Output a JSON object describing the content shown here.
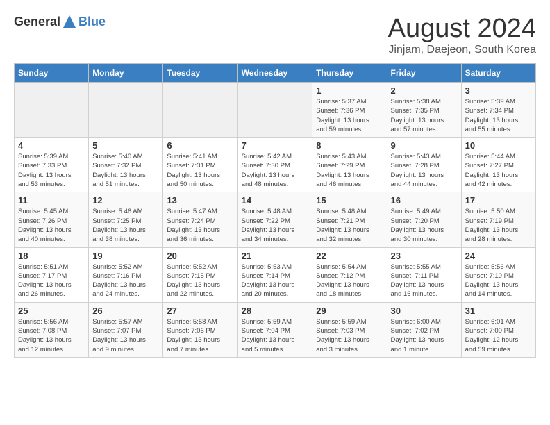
{
  "header": {
    "logo_general": "General",
    "logo_blue": "Blue",
    "month_title": "August 2024",
    "subtitle": "Jinjam, Daejeon, South Korea"
  },
  "weekdays": [
    "Sunday",
    "Monday",
    "Tuesday",
    "Wednesday",
    "Thursday",
    "Friday",
    "Saturday"
  ],
  "weeks": [
    [
      {
        "day": "",
        "info": ""
      },
      {
        "day": "",
        "info": ""
      },
      {
        "day": "",
        "info": ""
      },
      {
        "day": "",
        "info": ""
      },
      {
        "day": "1",
        "info": "Sunrise: 5:37 AM\nSunset: 7:36 PM\nDaylight: 13 hours\nand 59 minutes."
      },
      {
        "day": "2",
        "info": "Sunrise: 5:38 AM\nSunset: 7:35 PM\nDaylight: 13 hours\nand 57 minutes."
      },
      {
        "day": "3",
        "info": "Sunrise: 5:39 AM\nSunset: 7:34 PM\nDaylight: 13 hours\nand 55 minutes."
      }
    ],
    [
      {
        "day": "4",
        "info": "Sunrise: 5:39 AM\nSunset: 7:33 PM\nDaylight: 13 hours\nand 53 minutes."
      },
      {
        "day": "5",
        "info": "Sunrise: 5:40 AM\nSunset: 7:32 PM\nDaylight: 13 hours\nand 51 minutes."
      },
      {
        "day": "6",
        "info": "Sunrise: 5:41 AM\nSunset: 7:31 PM\nDaylight: 13 hours\nand 50 minutes."
      },
      {
        "day": "7",
        "info": "Sunrise: 5:42 AM\nSunset: 7:30 PM\nDaylight: 13 hours\nand 48 minutes."
      },
      {
        "day": "8",
        "info": "Sunrise: 5:43 AM\nSunset: 7:29 PM\nDaylight: 13 hours\nand 46 minutes."
      },
      {
        "day": "9",
        "info": "Sunrise: 5:43 AM\nSunset: 7:28 PM\nDaylight: 13 hours\nand 44 minutes."
      },
      {
        "day": "10",
        "info": "Sunrise: 5:44 AM\nSunset: 7:27 PM\nDaylight: 13 hours\nand 42 minutes."
      }
    ],
    [
      {
        "day": "11",
        "info": "Sunrise: 5:45 AM\nSunset: 7:26 PM\nDaylight: 13 hours\nand 40 minutes."
      },
      {
        "day": "12",
        "info": "Sunrise: 5:46 AM\nSunset: 7:25 PM\nDaylight: 13 hours\nand 38 minutes."
      },
      {
        "day": "13",
        "info": "Sunrise: 5:47 AM\nSunset: 7:24 PM\nDaylight: 13 hours\nand 36 minutes."
      },
      {
        "day": "14",
        "info": "Sunrise: 5:48 AM\nSunset: 7:22 PM\nDaylight: 13 hours\nand 34 minutes."
      },
      {
        "day": "15",
        "info": "Sunrise: 5:48 AM\nSunset: 7:21 PM\nDaylight: 13 hours\nand 32 minutes."
      },
      {
        "day": "16",
        "info": "Sunrise: 5:49 AM\nSunset: 7:20 PM\nDaylight: 13 hours\nand 30 minutes."
      },
      {
        "day": "17",
        "info": "Sunrise: 5:50 AM\nSunset: 7:19 PM\nDaylight: 13 hours\nand 28 minutes."
      }
    ],
    [
      {
        "day": "18",
        "info": "Sunrise: 5:51 AM\nSunset: 7:17 PM\nDaylight: 13 hours\nand 26 minutes."
      },
      {
        "day": "19",
        "info": "Sunrise: 5:52 AM\nSunset: 7:16 PM\nDaylight: 13 hours\nand 24 minutes."
      },
      {
        "day": "20",
        "info": "Sunrise: 5:52 AM\nSunset: 7:15 PM\nDaylight: 13 hours\nand 22 minutes."
      },
      {
        "day": "21",
        "info": "Sunrise: 5:53 AM\nSunset: 7:14 PM\nDaylight: 13 hours\nand 20 minutes."
      },
      {
        "day": "22",
        "info": "Sunrise: 5:54 AM\nSunset: 7:12 PM\nDaylight: 13 hours\nand 18 minutes."
      },
      {
        "day": "23",
        "info": "Sunrise: 5:55 AM\nSunset: 7:11 PM\nDaylight: 13 hours\nand 16 minutes."
      },
      {
        "day": "24",
        "info": "Sunrise: 5:56 AM\nSunset: 7:10 PM\nDaylight: 13 hours\nand 14 minutes."
      }
    ],
    [
      {
        "day": "25",
        "info": "Sunrise: 5:56 AM\nSunset: 7:08 PM\nDaylight: 13 hours\nand 12 minutes."
      },
      {
        "day": "26",
        "info": "Sunrise: 5:57 AM\nSunset: 7:07 PM\nDaylight: 13 hours\nand 9 minutes."
      },
      {
        "day": "27",
        "info": "Sunrise: 5:58 AM\nSunset: 7:06 PM\nDaylight: 13 hours\nand 7 minutes."
      },
      {
        "day": "28",
        "info": "Sunrise: 5:59 AM\nSunset: 7:04 PM\nDaylight: 13 hours\nand 5 minutes."
      },
      {
        "day": "29",
        "info": "Sunrise: 5:59 AM\nSunset: 7:03 PM\nDaylight: 13 hours\nand 3 minutes."
      },
      {
        "day": "30",
        "info": "Sunrise: 6:00 AM\nSunset: 7:02 PM\nDaylight: 13 hours\nand 1 minute."
      },
      {
        "day": "31",
        "info": "Sunrise: 6:01 AM\nSunset: 7:00 PM\nDaylight: 12 hours\nand 59 minutes."
      }
    ]
  ]
}
